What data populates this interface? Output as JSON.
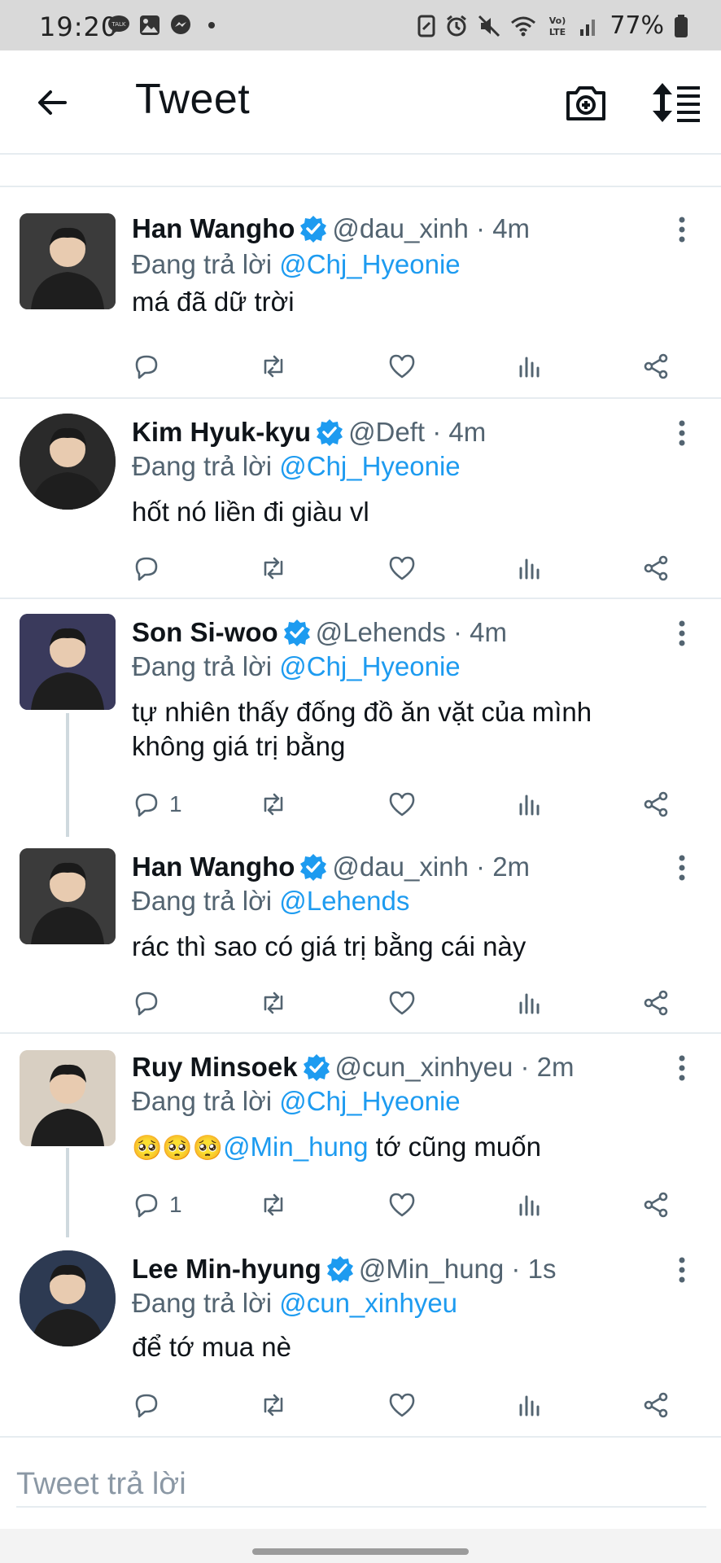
{
  "status_bar": {
    "time": "19:20",
    "battery": "77%",
    "icons_left": [
      "talk-icon",
      "gallery-icon",
      "messenger-icon",
      "dot-icon"
    ],
    "icons_right": [
      "nfc-icon",
      "alarm-icon",
      "mute-icon",
      "wifi-icon",
      "volte-icon",
      "signal-icon",
      "battery-icon"
    ]
  },
  "header": {
    "title": "Tweet"
  },
  "tweets": [
    {
      "name": "Han Wangho",
      "handle": "@dau_xinh · 4m",
      "replying_prefix": "Đang trả lời ",
      "replying_to": "@Chj_Hyeonie",
      "text": "má đã dữ trời",
      "replies": "",
      "avatar_bg": "#3b3b3b"
    },
    {
      "name": "Kim Hyuk-kyu",
      "handle": "@Deft · 4m",
      "replying_prefix": "Đang trả lời ",
      "replying_to": "@Chj_Hyeonie",
      "text": "hốt nó liền đi giàu vl",
      "replies": "",
      "avatar_bg": "#2a2a2a"
    },
    {
      "name": "Son Si-woo",
      "handle": "@Lehends · 4m",
      "replying_prefix": "Đang trả lời ",
      "replying_to": "@Chj_Hyeonie",
      "text": "tự nhiên thấy đống đồ ăn vặt của mình không giá trị bằng",
      "replies": "1",
      "avatar_bg": "#3a3a5c"
    },
    {
      "name": "Han Wangho",
      "handle": "@dau_xinh · 2m",
      "replying_prefix": "Đang trả lời ",
      "replying_to": "@Lehends",
      "text": "rác thì sao có giá trị bằng cái này",
      "replies": "",
      "avatar_bg": "#3b3b3b"
    },
    {
      "name": "Ruy Minsoek",
      "handle": "@cun_xinhyeu · 2m",
      "replying_prefix": "Đang trả lời ",
      "replying_to": "@Chj_Hyeonie",
      "emoji": "🥺🥺🥺",
      "mention": "@Min_hung",
      "text": " tớ cũng muốn",
      "replies": "1",
      "avatar_bg": "#d8cfc2"
    },
    {
      "name": "Lee Min-hyung",
      "handle": "@Min_hung · 1s",
      "replying_prefix": "Đang trả lời ",
      "replying_to": "@cun_xinhyeu",
      "text": "để tớ mua nè",
      "replies": "",
      "avatar_bg": "#2d3a52"
    }
  ],
  "reply_input": {
    "placeholder": "Tweet trả lời"
  },
  "colors": {
    "accent": "#1d9bf0",
    "muted": "#536471",
    "divider": "#e6ecf0"
  }
}
